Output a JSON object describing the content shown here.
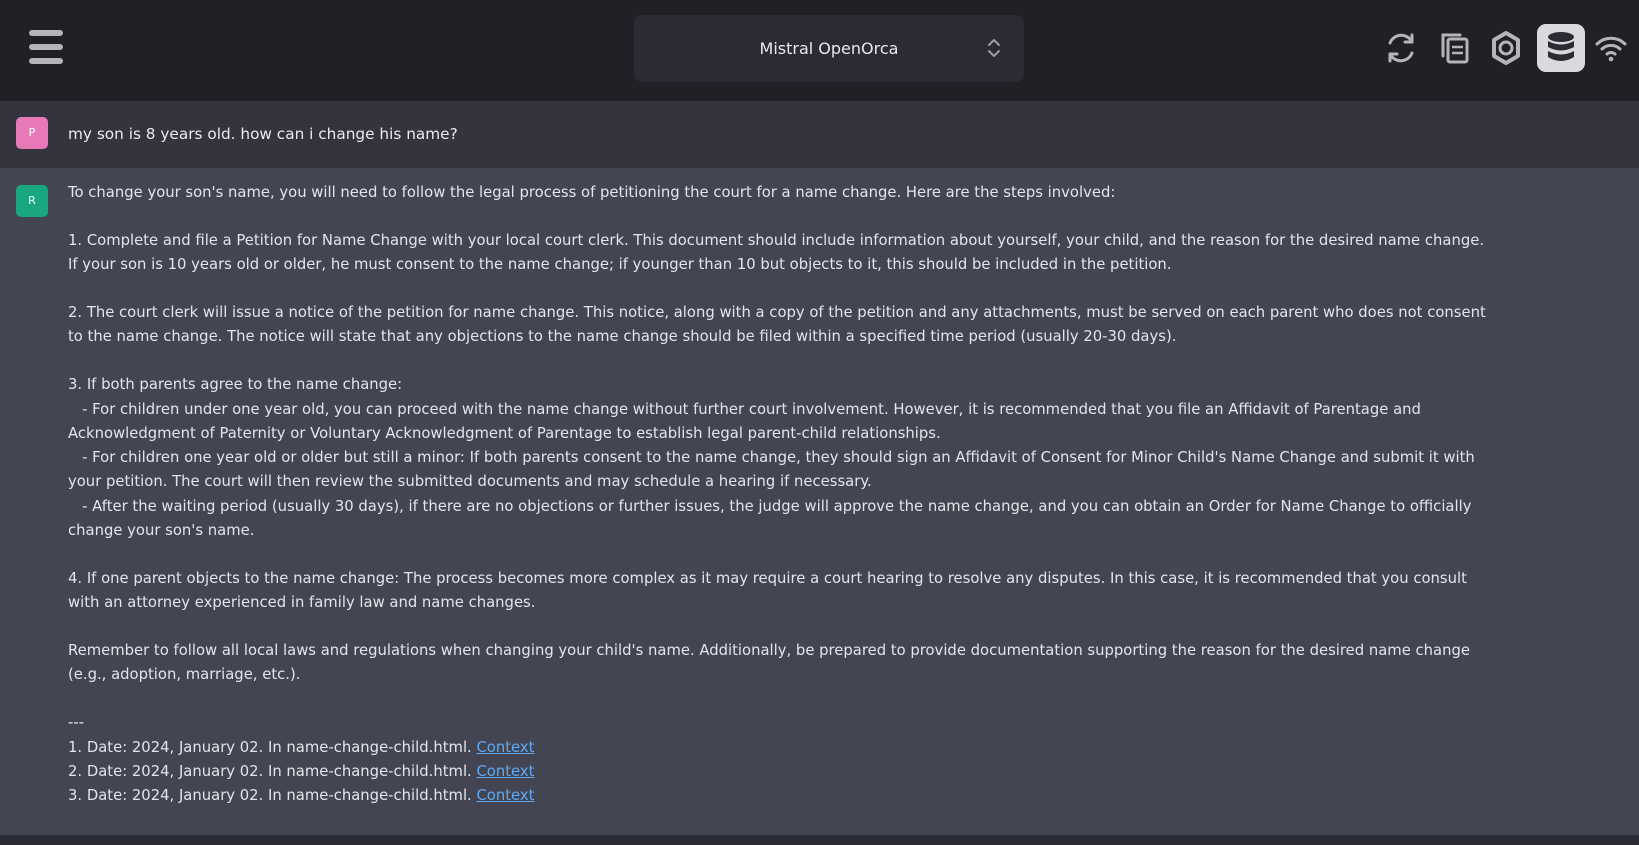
{
  "header": {
    "model_select": {
      "selected": "Mistral OpenOrca"
    },
    "icons": [
      "menu-icon",
      "reset-context-icon",
      "copy-icon",
      "settings-icon",
      "localdocs-database-icon",
      "network-icon"
    ]
  },
  "prompt": {
    "avatar": "P",
    "text": "my son is 8 years old. how can i change his name?"
  },
  "response": {
    "avatar": "R",
    "intro": "To change your son's name, you will need to follow the legal process of petitioning the court for a name change. Here are the steps involved:",
    "step1": [
      "1. Complete and file a Petition for Name Change with your local court clerk. This document should include information about yourself, your child, and the reason for the desired name change.",
      "If your son is 10 years old or older, he must consent to the name change; if younger than 10 but objects to it, this should be included in the petition."
    ],
    "step2": [
      "2. The court clerk will issue a notice of the petition for name change. This notice, along with a copy of the petition and any attachments, must be served on each parent who does not consent",
      "to the name change. The notice will state that any objections to the name change should be filed within a specified time period (usually 20-30 days)."
    ],
    "step3": [
      "3. If both parents agree to the name change:",
      "   - For children under one year old, you can proceed with the name change without further court involvement. However, it is recommended that you file an Affidavit of Parentage and",
      "Acknowledgment of Paternity or Voluntary Acknowledgment of Parentage to establish legal parent-child relationships.",
      "   - For children one year old or older but still a minor: If both parents consent to the name change, they should sign an Affidavit of Consent for Minor Child's Name Change and submit it with",
      "your petition. The court will then review the submitted documents and may schedule a hearing if necessary.",
      "   - After the waiting period (usually 30 days), if there are no objections or further issues, the judge will approve the name change, and you can obtain an Order for Name Change to officially",
      "change your son's name."
    ],
    "step4": [
      "4. If one parent objects to the name change: The process becomes more complex as it may require a court hearing to resolve any disputes. In this case, it is recommended that you consult",
      "with an attorney experienced in family law and name changes."
    ],
    "closing": [
      "Remember to follow all local laws and regulations when changing your child's name. Additionally, be prepared to provide documentation supporting the reason for the desired name change",
      "(e.g., adoption, marriage, etc.)."
    ],
    "separator": "---",
    "sources": [
      {
        "text": "1. Date: 2024, January 02. In name-change-child.html. ",
        "link": "Context"
      },
      {
        "text": "2. Date: 2024, January 02. In name-change-child.html. ",
        "link": "Context"
      },
      {
        "text": "3. Date: 2024, January 02. In name-change-child.html. ",
        "link": "Context"
      }
    ]
  }
}
